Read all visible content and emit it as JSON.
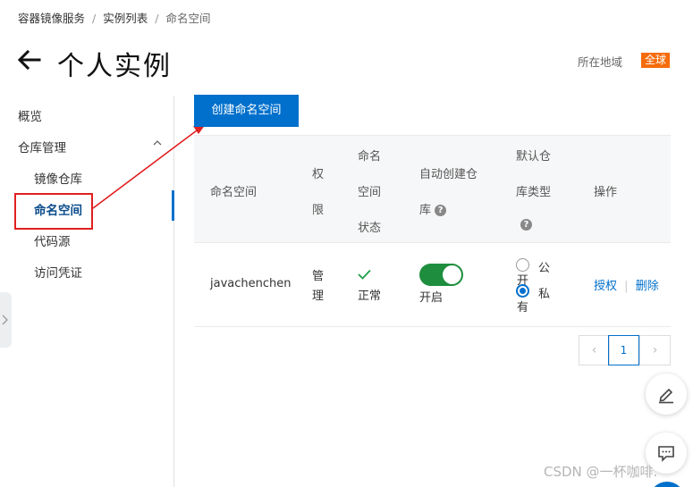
{
  "breadcrumb": {
    "items": [
      "容器镜像服务",
      "实例列表"
    ],
    "current": "命名空间",
    "separator": "/"
  },
  "header": {
    "title": "个人实例",
    "region_label": "所在地域",
    "region_value": "全球"
  },
  "sidebar": {
    "items": [
      {
        "label": "概览"
      },
      {
        "label": "仓库管理"
      },
      {
        "label": "镜像仓库"
      },
      {
        "label": "命名空间"
      },
      {
        "label": "代码源"
      },
      {
        "label": "访问凭证"
      }
    ],
    "active": "命名空间"
  },
  "toolbar": {
    "create_label": "创建命名空间"
  },
  "table": {
    "headers": {
      "namespace": "命名空间",
      "perm": [
        "权",
        "限"
      ],
      "status": [
        "命名",
        "空间",
        "状态"
      ],
      "auto_create": [
        "自动创建仓",
        "库"
      ],
      "default_type": [
        "默认仓",
        "库类型"
      ],
      "actions": "操作"
    },
    "rows": [
      {
        "namespace": "javachenchen",
        "perm": [
          "管",
          "理"
        ],
        "status": "正常",
        "auto_create": "开启",
        "public_label": [
          "公",
          "开"
        ],
        "private_label": [
          "私",
          "有"
        ],
        "default_type": "私有",
        "actions": {
          "authorize": "授权",
          "separator": "|",
          "delete": "删除"
        }
      }
    ]
  },
  "pagination": {
    "prev": "‹",
    "current": "1",
    "next": "›"
  },
  "watermark": "CSDN @一杯咖啡.",
  "colors": {
    "primary": "#0070cc",
    "badge": "#f56c0b",
    "toggle_on": "#1e8e3e",
    "annotation": "#e02020"
  },
  "icons": [
    "back-arrow-icon",
    "chevron-up-icon",
    "help-icon",
    "check-icon",
    "edit-icon",
    "chat-icon"
  ]
}
